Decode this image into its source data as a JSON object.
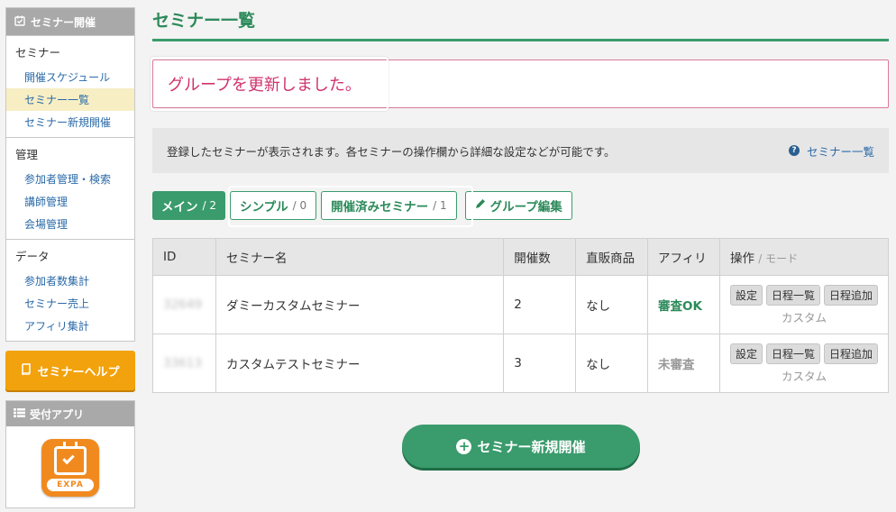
{
  "sidebar": {
    "header": "セミナー開催",
    "sections": [
      {
        "title": "セミナー",
        "items": [
          "開催スケジュール",
          "セミナー一覧",
          "セミナー新規開催"
        ]
      },
      {
        "title": "管理",
        "items": [
          "参加者管理・検索",
          "講師管理",
          "会場管理"
        ]
      },
      {
        "title": "データ",
        "items": [
          "参加者数集計",
          "セミナー売上",
          "アフィリ集計"
        ]
      }
    ],
    "help_label": "セミナーヘルプ",
    "app_header": "受付アプリ",
    "app_brand": "EXPA"
  },
  "main": {
    "title": "セミナー一覧",
    "flash": "グループを更新しました。",
    "notice": "登録したセミナーが表示されます。各セミナーの操作欄から詳細な設定などが可能です。",
    "notice_link": "セミナー一覧",
    "tabs": [
      {
        "label": "メイン",
        "count": "/ 2"
      },
      {
        "label": "シンプル",
        "count": "/ 0"
      },
      {
        "label": "開催済みセミナー",
        "count": "/ 1"
      }
    ],
    "group_edit": "グループ編集",
    "table": {
      "headers": [
        "ID",
        "セミナー名",
        "開催数",
        "直販商品",
        "アフィリ",
        "操作",
        "/ モード"
      ],
      "rows": [
        {
          "id": "32649",
          "name": "ダミーカスタムセミナー",
          "count": "2",
          "direct": "なし",
          "affiliate": "審査OK",
          "mode": "カスタム"
        },
        {
          "id": "33613",
          "name": "カスタムテストセミナー",
          "count": "3",
          "direct": "なし",
          "affiliate": "未審査",
          "mode": "カスタム"
        }
      ],
      "ops": [
        "設定",
        "日程一覧",
        "日程追加"
      ]
    },
    "new_button": "セミナー新規開催"
  },
  "colors": {
    "accent": "#3a9b6c",
    "flash": "#d0326d",
    "help": "#f2a20c",
    "link": "#2a6aa8"
  }
}
